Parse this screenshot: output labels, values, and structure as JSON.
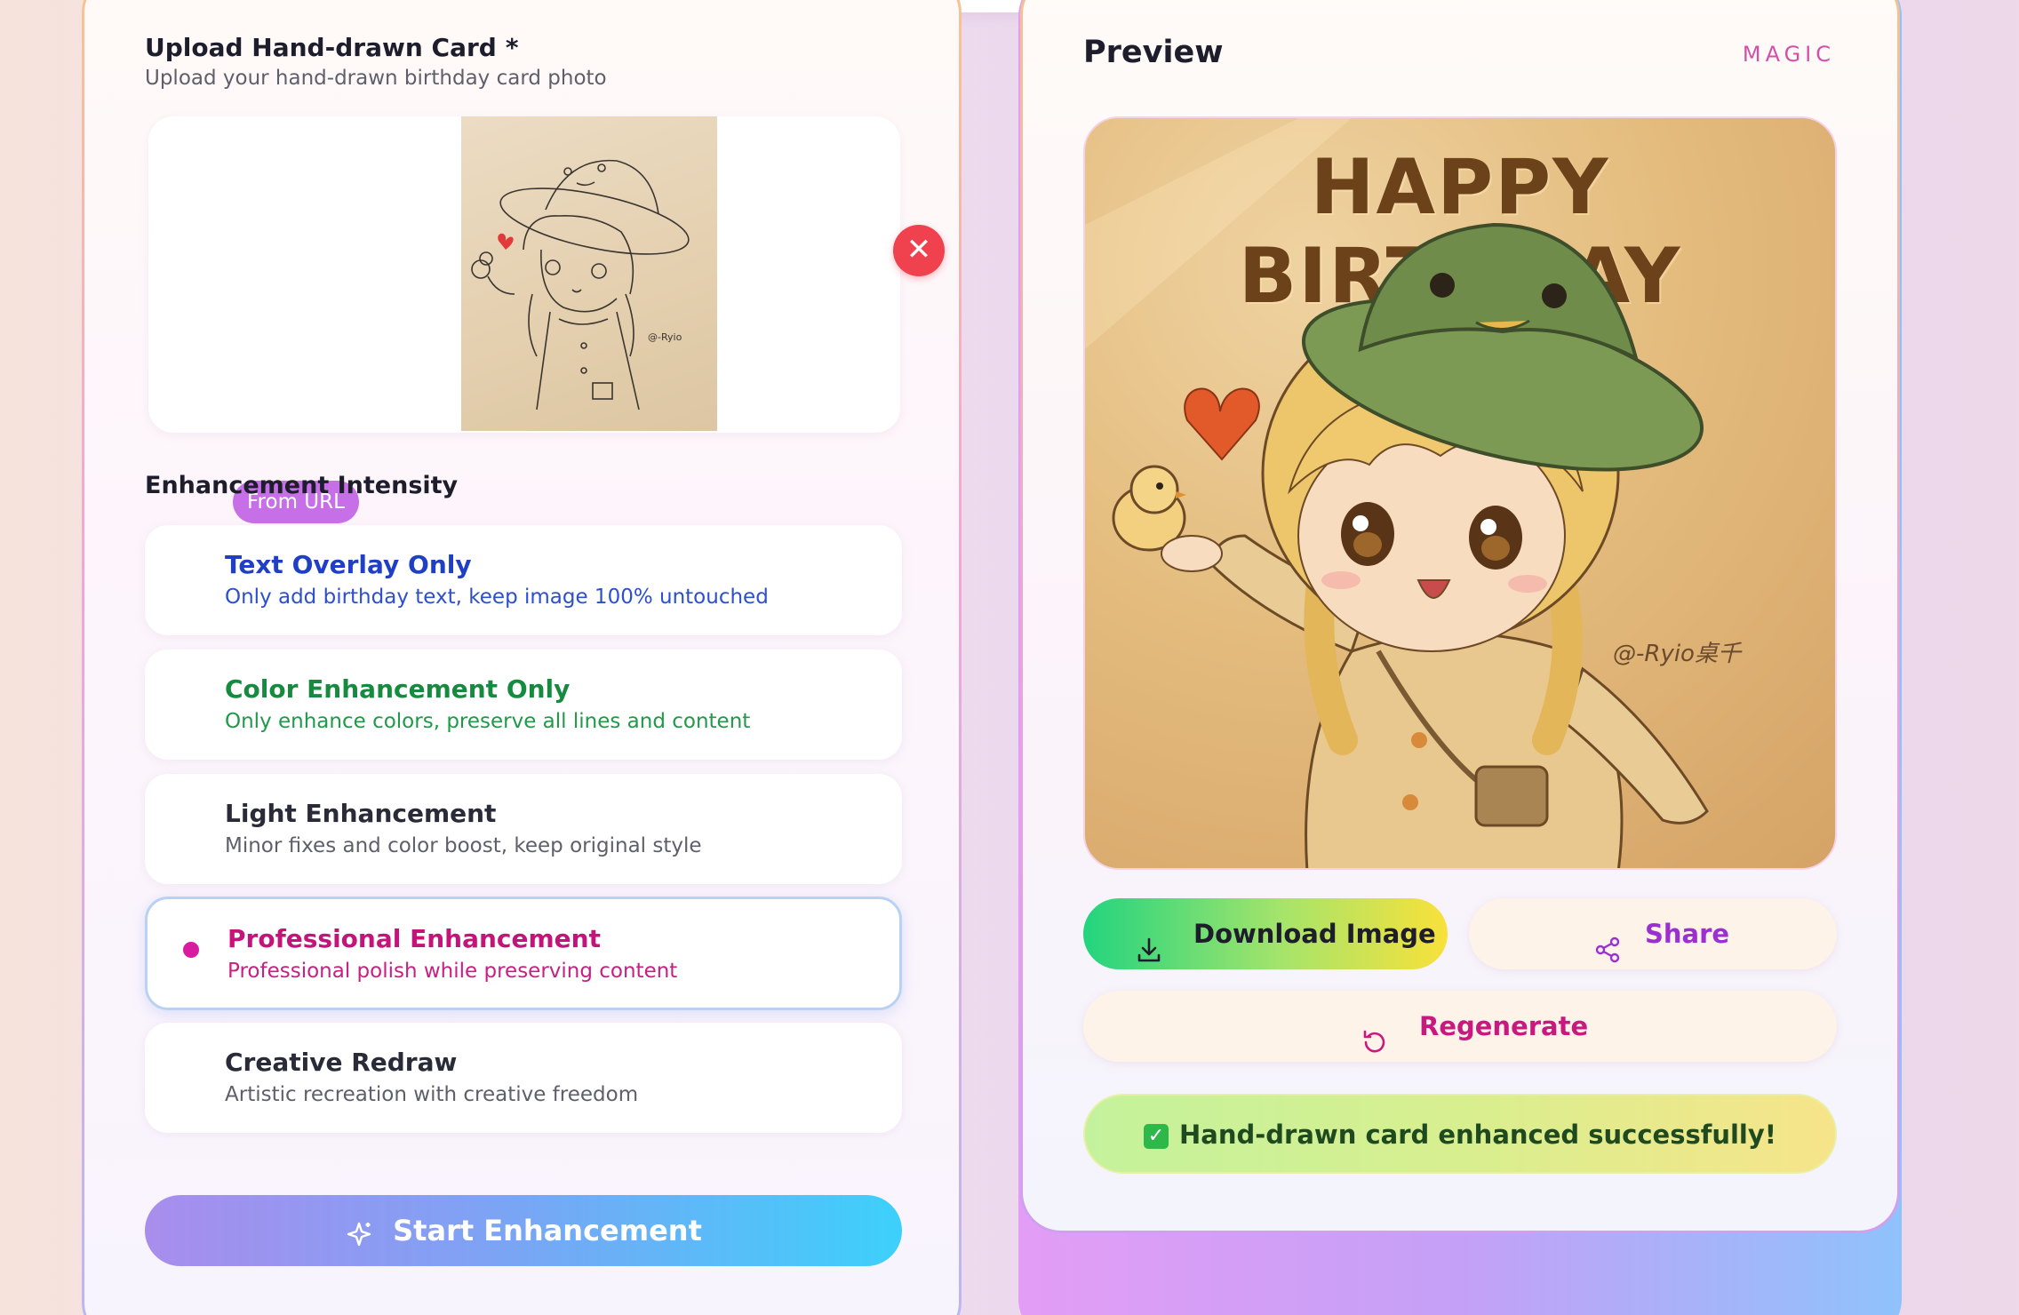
{
  "upload": {
    "title": "Upload Hand-drawn Card",
    "required_mark": "*",
    "subtitle": "Upload your hand-drawn birthday card photo",
    "from_url_label": "From URL",
    "remove_icon": "close-icon",
    "sketch_signature": "@-Ryio桌千"
  },
  "intensity": {
    "title": "Enhancement Intensity",
    "options": [
      {
        "title": "Text Overlay Only",
        "desc": "Only add birthday text, keep image 100% untouched",
        "color": "#1f3fc4"
      },
      {
        "title": "Color Enhancement Only",
        "desc": "Only enhance colors, preserve all lines and content",
        "color": "#168a3e"
      },
      {
        "title": "Light Enhancement",
        "desc": "Minor fixes and color boost, keep original style",
        "color": "#2a2a38"
      },
      {
        "title": "Professional Enhancement",
        "desc": "Professional polish while preserving content",
        "color": "#c4147a"
      },
      {
        "title": "Creative Redraw",
        "desc": "Artistic recreation with creative freedom",
        "color": "#2a2a38"
      }
    ],
    "selected_index": 3
  },
  "start_button": {
    "label": "Start Enhancement",
    "icon": "sparkle-icon"
  },
  "preview": {
    "title": "Preview",
    "tag": "MAGIC",
    "image_text": "HAPPY BIRTHDAY",
    "signature": "@-Ryio桌千"
  },
  "actions": {
    "download_label": "Download Image",
    "download_icon": "download-icon",
    "share_label": "Share",
    "share_icon": "share-icon",
    "regenerate_label": "Regenerate",
    "regenerate_icon": "refresh-icon"
  },
  "status": {
    "message": "Hand-drawn card enhanced successfully!",
    "icon": "check-icon"
  }
}
